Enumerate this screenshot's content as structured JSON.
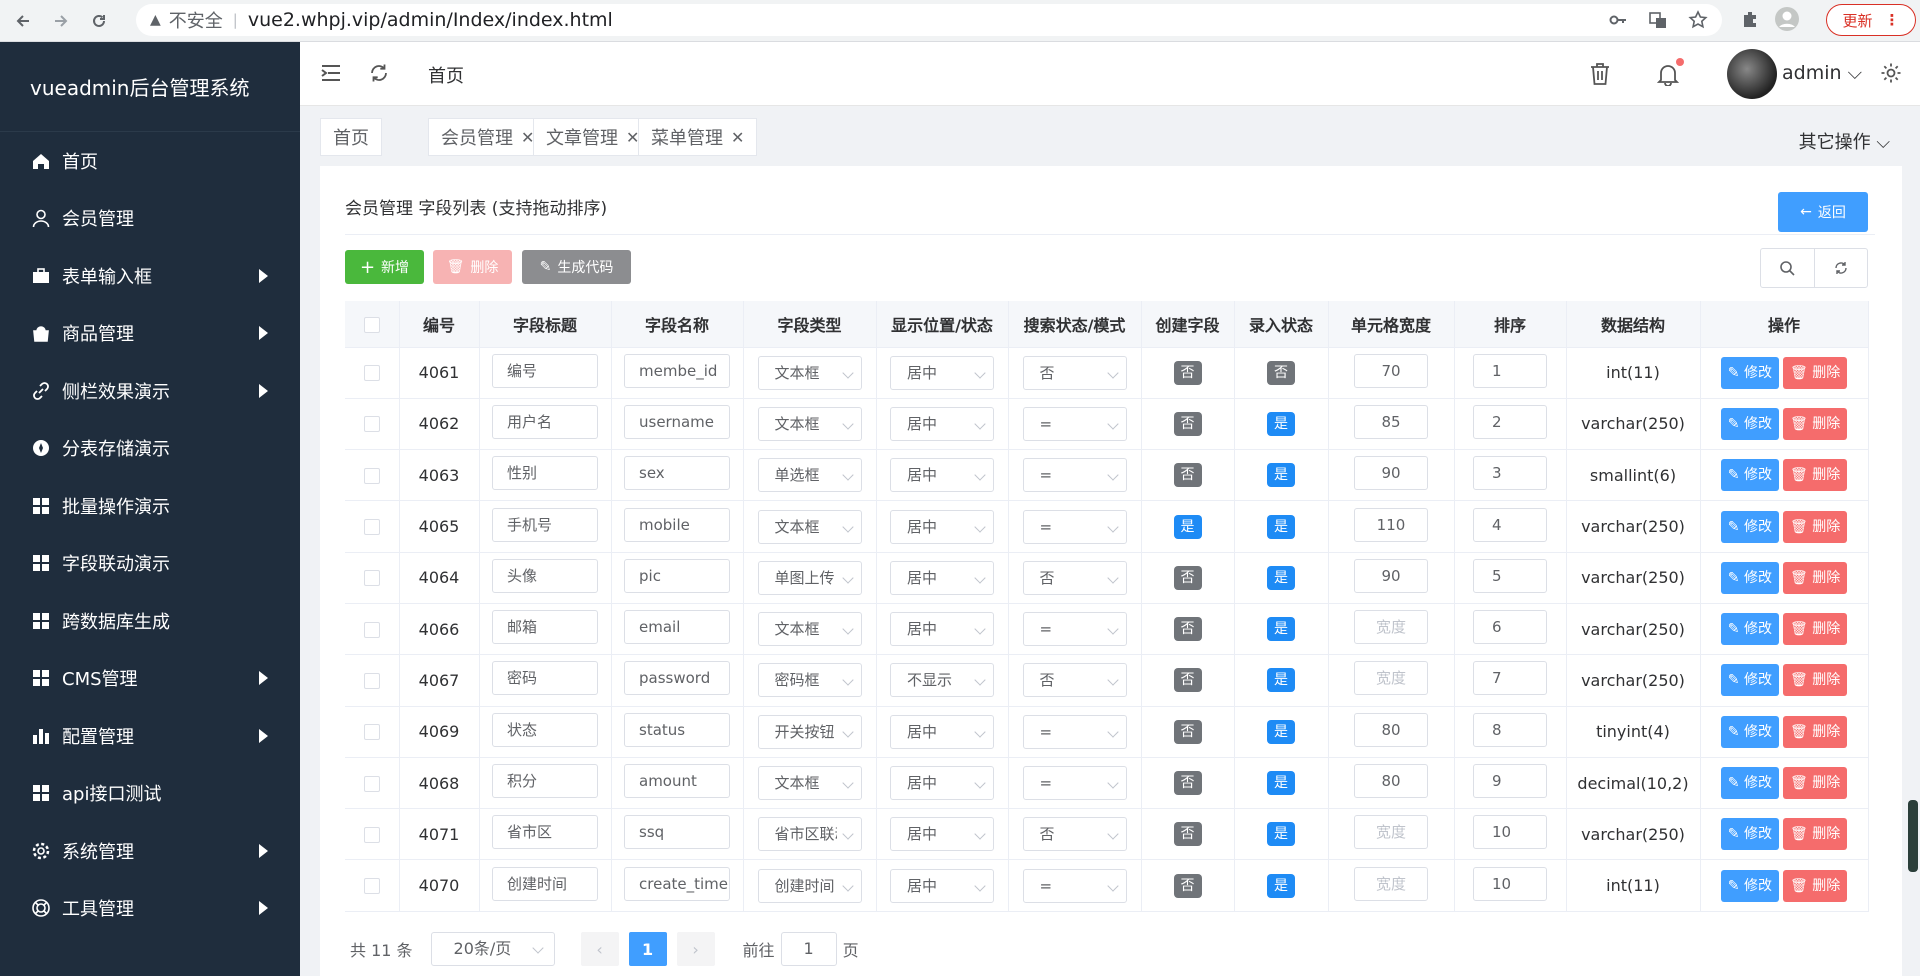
{
  "browser": {
    "security_label": "不安全",
    "url": "vue2.whpj.vip/admin/Index/index.html",
    "update_label": "更新"
  },
  "sidebar": {
    "brand": "vueadmin后台管理系统",
    "items": [
      {
        "label": "首页",
        "icon": "home-icon",
        "has_submenu": false
      },
      {
        "label": "会员管理",
        "icon": "user-icon",
        "has_submenu": false
      },
      {
        "label": "表单输入框",
        "icon": "briefcase-icon",
        "has_submenu": true
      },
      {
        "label": "商品管理",
        "icon": "shop-icon",
        "has_submenu": true
      },
      {
        "label": "侧栏效果演示",
        "icon": "link-icon",
        "has_submenu": true
      },
      {
        "label": "分表存储演示",
        "icon": "compass-icon",
        "has_submenu": false
      },
      {
        "label": "批量操作演示",
        "icon": "grid-icon",
        "has_submenu": false
      },
      {
        "label": "字段联动演示",
        "icon": "grid-icon",
        "has_submenu": false
      },
      {
        "label": "跨数据库生成",
        "icon": "grid-icon",
        "has_submenu": false
      },
      {
        "label": "CMS管理",
        "icon": "grid-icon",
        "has_submenu": true
      },
      {
        "label": "配置管理",
        "icon": "bar-chart-icon",
        "has_submenu": true
      },
      {
        "label": "api接口测试",
        "icon": "grid-icon",
        "has_submenu": false
      },
      {
        "label": "系统管理",
        "icon": "gear-icon",
        "has_submenu": true
      },
      {
        "label": "工具管理",
        "icon": "lifebuoy-icon",
        "has_submenu": true
      }
    ]
  },
  "header": {
    "breadcrumb": "首页",
    "username": "admin"
  },
  "tabs": {
    "items": [
      {
        "label": "首页",
        "closable": false
      },
      {
        "label": "会员管理",
        "closable": true
      },
      {
        "label": "文章管理",
        "closable": true
      },
      {
        "label": "菜单管理",
        "closable": true
      }
    ],
    "other_ops": "其它操作"
  },
  "page": {
    "title": "会员管理 字段列表 (支持拖动排序)",
    "back_label": "返回",
    "add_label": "新增",
    "delete_label": "删除",
    "gen_label": "生成代码"
  },
  "table": {
    "columns": [
      "编号",
      "字段标题",
      "字段名称",
      "字段类型",
      "显示位置/状态",
      "搜索状态/模式",
      "创建字段",
      "录入状态",
      "单元格宽度",
      "排序",
      "数据结构",
      "操作"
    ],
    "width_placeholder": "宽度",
    "edit_label": "修改",
    "delete_label": "删除",
    "rows": [
      {
        "id": "4061",
        "title": "编号",
        "name": "membe_id",
        "type": "文本框",
        "align": "居中",
        "search": "否",
        "create": "否",
        "entry": "否",
        "width": "70",
        "sort": "1",
        "struct": "int(11)"
      },
      {
        "id": "4062",
        "title": "用户名",
        "name": "username",
        "type": "文本框",
        "align": "居中",
        "search": "=",
        "create": "否",
        "entry": "是",
        "width": "85",
        "sort": "2",
        "struct": "varchar(250)"
      },
      {
        "id": "4063",
        "title": "性别",
        "name": "sex",
        "type": "单选框",
        "align": "居中",
        "search": "=",
        "create": "否",
        "entry": "是",
        "width": "90",
        "sort": "3",
        "struct": "smallint(6)"
      },
      {
        "id": "4065",
        "title": "手机号",
        "name": "mobile",
        "type": "文本框",
        "align": "居中",
        "search": "=",
        "create": "是",
        "entry": "是",
        "width": "110",
        "sort": "4",
        "struct": "varchar(250)"
      },
      {
        "id": "4064",
        "title": "头像",
        "name": "pic",
        "type": "单图上传",
        "align": "居中",
        "search": "否",
        "create": "否",
        "entry": "是",
        "width": "90",
        "sort": "5",
        "struct": "varchar(250)"
      },
      {
        "id": "4066",
        "title": "邮箱",
        "name": "email",
        "type": "文本框",
        "align": "居中",
        "search": "=",
        "create": "否",
        "entry": "是",
        "width": "",
        "sort": "6",
        "struct": "varchar(250)"
      },
      {
        "id": "4067",
        "title": "密码",
        "name": "password",
        "type": "密码框",
        "align": "不显示",
        "search": "否",
        "create": "否",
        "entry": "是",
        "width": "",
        "sort": "7",
        "struct": "varchar(250)"
      },
      {
        "id": "4069",
        "title": "状态",
        "name": "status",
        "type": "开关按钮",
        "align": "居中",
        "search": "=",
        "create": "否",
        "entry": "是",
        "width": "80",
        "sort": "8",
        "struct": "tinyint(4)"
      },
      {
        "id": "4068",
        "title": "积分",
        "name": "amount",
        "type": "文本框",
        "align": "居中",
        "search": "=",
        "create": "否",
        "entry": "是",
        "width": "80",
        "sort": "9",
        "struct": "decimal(10,2)"
      },
      {
        "id": "4071",
        "title": "省市区",
        "name": "ssq",
        "type": "省市区联动",
        "align": "居中",
        "search": "否",
        "create": "否",
        "entry": "是",
        "width": "",
        "sort": "10",
        "struct": "varchar(250)"
      },
      {
        "id": "4070",
        "title": "创建时间",
        "name": "create_time",
        "type": "创建时间",
        "align": "居中",
        "search": "=",
        "create": "否",
        "entry": "是",
        "width": "",
        "sort": "10",
        "struct": "int(11)"
      }
    ]
  },
  "pagination": {
    "total_label": "共 11 条",
    "page_size": "20条/页",
    "current_page": "1",
    "goto_prefix": "前往",
    "goto_value": "1",
    "goto_suffix": "页"
  }
}
